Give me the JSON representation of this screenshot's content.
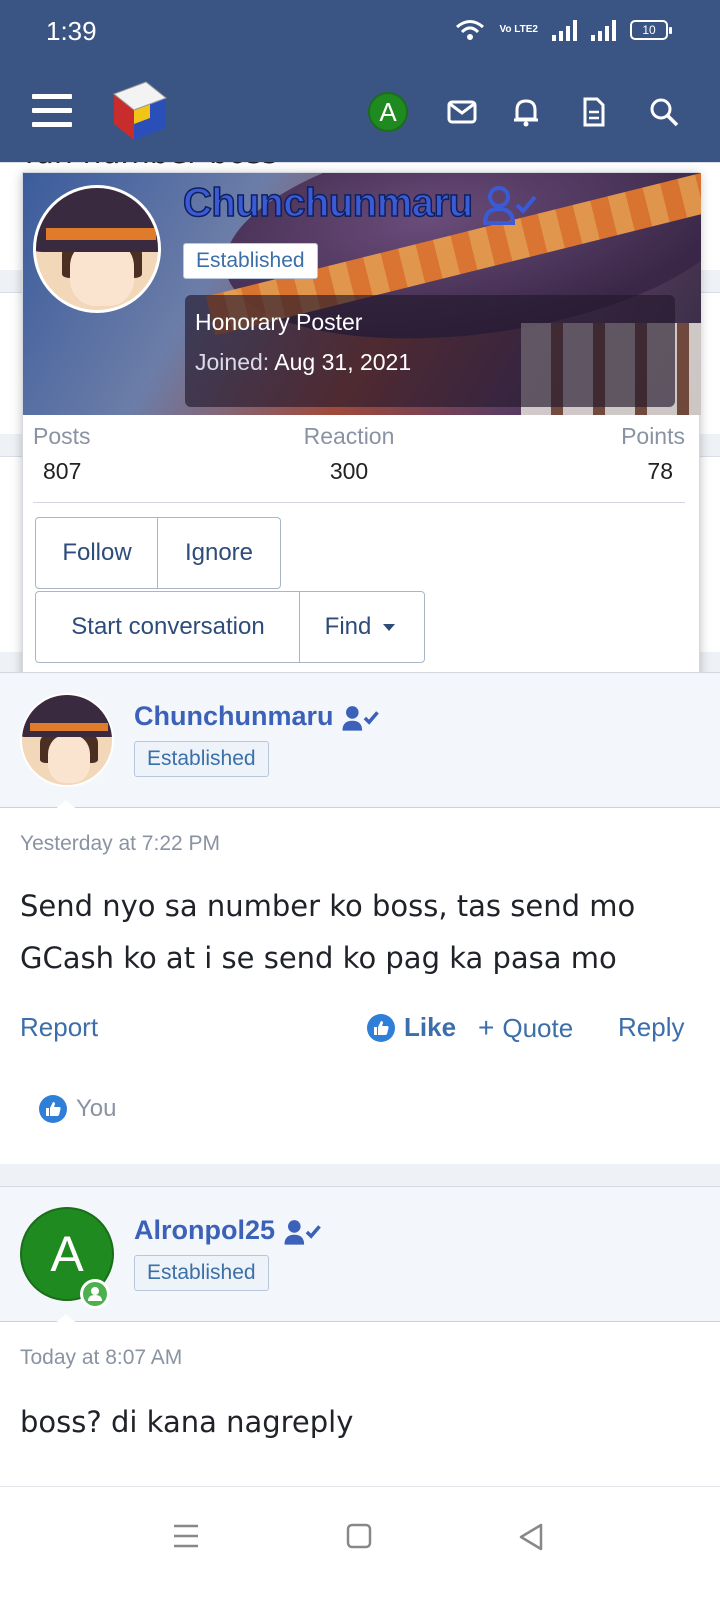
{
  "status_bar": {
    "time": "1:39",
    "network": "Vo LTE2",
    "battery": "10"
  },
  "header": {
    "account_initial": "A"
  },
  "background": {
    "partial_text": "Yun number boss"
  },
  "popup": {
    "username": "Chunchunmaru",
    "badge": "Established",
    "user_title": "Honorary Poster",
    "joined_label": "Joined:",
    "joined_date": "Aug 31, 2021",
    "stats": [
      {
        "label": "Posts",
        "value": "807"
      },
      {
        "label": "Reaction",
        "value": "300"
      },
      {
        "label": "Points",
        "value": "78"
      }
    ],
    "buttons": {
      "follow": "Follow",
      "ignore": "Ignore",
      "start_conversation": "Start conversation",
      "find": "Find"
    }
  },
  "posts": [
    {
      "username": "Chunchunmaru",
      "badge": "Established",
      "date": "Yesterday at 7:22 PM",
      "text": "Send nyo sa number ko boss, tas send mo GCash ko at i se send ko pag ka pasa mo",
      "actions": {
        "report": "Report",
        "like": "Like",
        "quote": "Quote",
        "reply": "Reply"
      },
      "reactions_by": "You"
    },
    {
      "username": "Alronpol25",
      "avatar_initial": "A",
      "badge": "Established",
      "date": "Today at 8:07 AM",
      "text": "boss? di kana nagreply"
    }
  ],
  "colors": {
    "header": "#3a5584",
    "link": "#3c61b8",
    "online": "#4caf50"
  }
}
